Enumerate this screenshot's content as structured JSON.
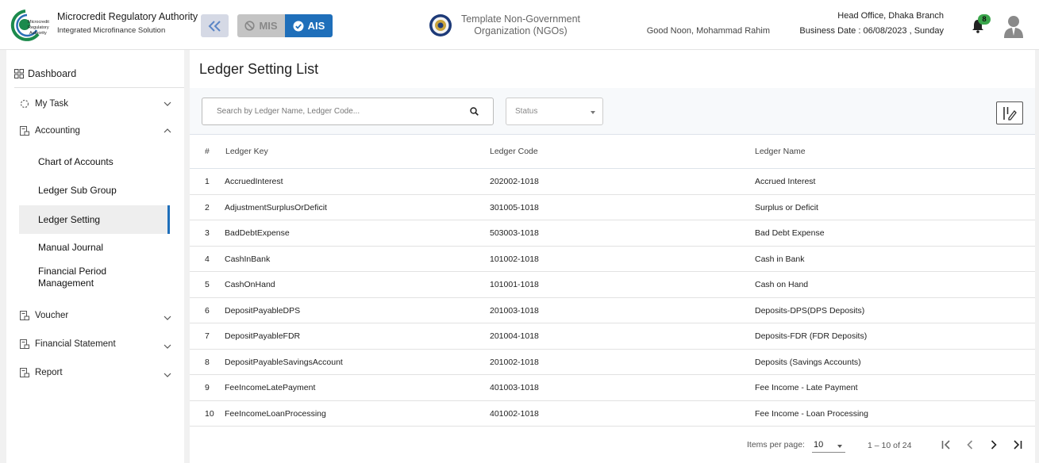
{
  "header": {
    "org_name": "Microcredit Regulatory Authority",
    "org_sub": "Integrated Microfinance Solution",
    "logo_text": [
      "Microcredit",
      "Regulatory",
      "Authority"
    ],
    "mode_mis": "MIS",
    "mode_ais": "AIS",
    "template_line1": "Template Non-Government",
    "template_line2": "Organization (NGOs)",
    "greeting": "Good Noon, Mohammad Rahim",
    "office": "Head Office, Dhaka Branch",
    "business_date": "Business Date : 06/08/2023 , Sunday",
    "notification_count": "8",
    "accent_color": "#1f6fba",
    "badge_color": "#3aa54b",
    "icons": [
      "double-chevron-left-icon",
      "block-icon",
      "check-circle-icon",
      "seal-icon",
      "bell-icon",
      "user-avatar-icon"
    ]
  },
  "sidebar": {
    "dashboard": "Dashboard",
    "items": [
      {
        "label": "My Task",
        "icon": "spinner-icon"
      },
      {
        "label": "Accounting",
        "icon": "ledger-icon"
      },
      {
        "label": "Voucher",
        "icon": "ledger-icon"
      },
      {
        "label": "Financial Statement",
        "icon": "ledger-icon"
      },
      {
        "label": "Report",
        "icon": "ledger-icon"
      }
    ],
    "accounting_sub": [
      {
        "label": "Chart of Accounts"
      },
      {
        "label": "Ledger Sub Group"
      },
      {
        "label": "Ledger Setting",
        "active": true
      },
      {
        "label": "Manual Journal"
      },
      {
        "label": "Financial Period Management"
      }
    ]
  },
  "main": {
    "title": "Ledger Setting List",
    "search_placeholder": "Search by Ledger Name, Ledger Code...",
    "status_placeholder": "Status",
    "columns": [
      "#",
      "Ledger Key",
      "Ledger Code",
      "Ledger Name"
    ],
    "rows": [
      {
        "no": "1",
        "key": "AccruedInterest",
        "code": "202002-1018",
        "name": "Accrued Interest"
      },
      {
        "no": "2",
        "key": "AdjustmentSurplusOrDeficit",
        "code": "301005-1018",
        "name": "Surplus or Deficit"
      },
      {
        "no": "3",
        "key": "BadDebtExpense",
        "code": "503003-1018",
        "name": "Bad Debt Expense"
      },
      {
        "no": "4",
        "key": "CashInBank",
        "code": "101002-1018",
        "name": "Cash in Bank"
      },
      {
        "no": "5",
        "key": "CashOnHand",
        "code": "101001-1018",
        "name": "Cash on Hand"
      },
      {
        "no": "6",
        "key": "DepositPayableDPS",
        "code": "201003-1018",
        "name": "Deposits-DPS(DPS Deposits)"
      },
      {
        "no": "7",
        "key": "DepositPayableFDR",
        "code": "201004-1018",
        "name": "Deposits-FDR (FDR Deposits)"
      },
      {
        "no": "8",
        "key": "DepositPayableSavingsAccount",
        "code": "201002-1018",
        "name": "Deposits (Savings Accounts)"
      },
      {
        "no": "9",
        "key": "FeeIncomeLatePayment",
        "code": "401003-1018",
        "name": "Fee Income - Late Payment"
      },
      {
        "no": "10",
        "key": "FeeIncomeLoanProcessing",
        "code": "401002-1018",
        "name": "Fee Income - Loan Processing"
      }
    ],
    "pagination": {
      "items_per_page_label": "Items per page:",
      "items_per_page": "10",
      "range": "1 – 10 of 24"
    }
  }
}
